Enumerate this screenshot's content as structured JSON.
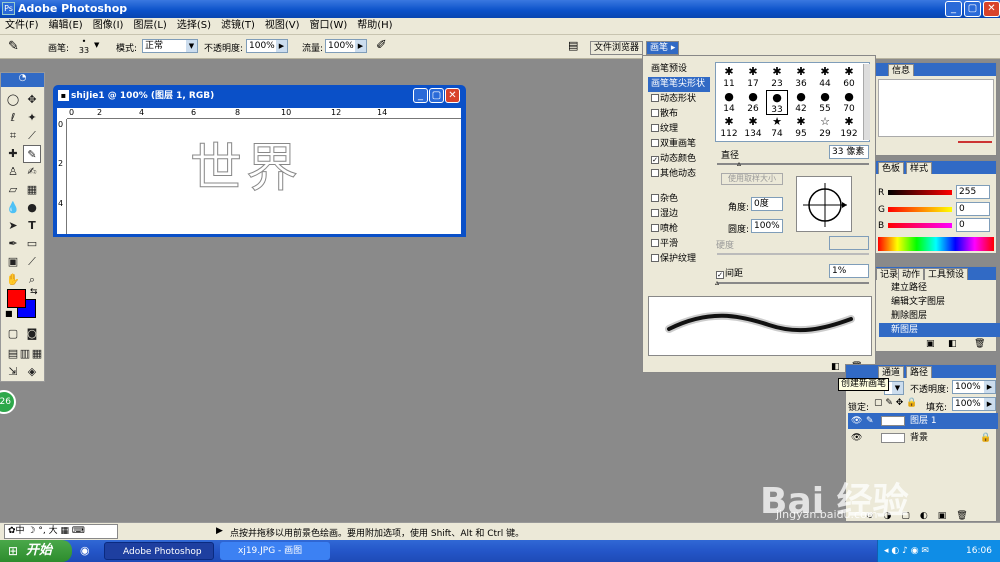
{
  "app": {
    "title": "Adobe Photoshop"
  },
  "menu": [
    "文件(F)",
    "编辑(E)",
    "图像(I)",
    "图层(L)",
    "选择(S)",
    "滤镜(T)",
    "视图(V)",
    "窗口(W)",
    "帮助(H)"
  ],
  "options": {
    "brush_label": "画笔:",
    "brush_size": "33",
    "mode_label": "模式:",
    "mode_value": "正常",
    "opacity_label": "不透明度:",
    "opacity_value": "100%",
    "flow_label": "流量:",
    "flow_value": "100%",
    "tab_file_browser": "文件浏览器",
    "tab_brushes": "画笔"
  },
  "document": {
    "title": "shiJie1 @ 100% (图层 1, RGB)",
    "text": "世界",
    "ruler_h": [
      "0",
      "2",
      "4",
      "6",
      "8",
      "10",
      "12",
      "14"
    ],
    "ruler_v": [
      "0",
      "2",
      "4"
    ]
  },
  "brush_panel": {
    "items": [
      {
        "label": "画笔预设",
        "checkbox": false,
        "checked": false,
        "selected": false
      },
      {
        "label": "画笔笔尖形状",
        "checkbox": false,
        "checked": false,
        "selected": true
      },
      {
        "label": "动态形状",
        "checkbox": true,
        "checked": false,
        "selected": false
      },
      {
        "label": "散布",
        "checkbox": true,
        "checked": false,
        "selected": false
      },
      {
        "label": "纹理",
        "checkbox": true,
        "checked": false,
        "selected": false
      },
      {
        "label": "双重画笔",
        "checkbox": true,
        "checked": false,
        "selected": false
      },
      {
        "label": "动态颜色",
        "checkbox": true,
        "checked": true,
        "selected": false
      },
      {
        "label": "其他动态",
        "checkbox": true,
        "checked": false,
        "selected": false
      },
      {
        "label": "杂色",
        "checkbox": true,
        "checked": false,
        "selected": false
      },
      {
        "label": "湿边",
        "checkbox": true,
        "checked": false,
        "selected": false
      },
      {
        "label": "喷枪",
        "checkbox": true,
        "checked": false,
        "selected": false
      },
      {
        "label": "平滑",
        "checkbox": true,
        "checked": false,
        "selected": false
      },
      {
        "label": "保护纹理",
        "checkbox": true,
        "checked": false,
        "selected": false
      }
    ],
    "tip_sizes": [
      "11",
      "17",
      "23",
      "36",
      "44",
      "60",
      "14",
      "26",
      "33",
      "42",
      "55",
      "70",
      "112",
      "134",
      "74",
      "95",
      "29",
      "192"
    ],
    "diameter_label": "直径",
    "diameter_value": "33 像素",
    "use_sample_size": "使用取样大小",
    "angle_label": "角度:",
    "angle_value": "0度",
    "roundness_label": "圆度:",
    "roundness_value": "100%",
    "hardness_label": "硬度",
    "spacing_label": "间距",
    "spacing_value": "1%"
  },
  "info_panel": {
    "tab": "信息"
  },
  "color_panel": {
    "tabs": [
      "色板",
      "样式"
    ],
    "r_label": "R",
    "r_value": "255",
    "g_label": "G",
    "g_value": "0",
    "b_label": "B",
    "b_value": "0"
  },
  "history_panel": {
    "tabs": [
      "记录",
      "动作",
      "工具预设"
    ],
    "items": [
      "建立路径",
      "编辑文字图层",
      "删除图层",
      "新图层"
    ]
  },
  "layers_panel": {
    "tabs": [
      "通道",
      "路径"
    ],
    "tooltip": "创建新画笔",
    "opacity_label": "不透明度:",
    "opacity_value": "100%",
    "lock_label": "锁定:",
    "fill_label": "填充:",
    "fill_value": "100%",
    "layers": [
      "图层 1",
      "背景"
    ]
  },
  "status": {
    "hint": "点按并拖移以用前景色绘画。要用附加选项，使用 Shift、Alt 和 Ctrl 键。",
    "ime": "中",
    "ime2": "大"
  },
  "taskbar": {
    "start": "开始",
    "tasks": [
      "Adobe Photoshop",
      "xj19.JPG - 画图"
    ],
    "time": "16:06"
  },
  "watermark": {
    "text": "Bai 经验",
    "url": "jingyan.baidu.com"
  },
  "badge": "26",
  "colors": {
    "foreground": "#ff0000",
    "background": "#0000ff",
    "workspace": "#8a8a8a",
    "xp_blue": "#0a50c8"
  }
}
